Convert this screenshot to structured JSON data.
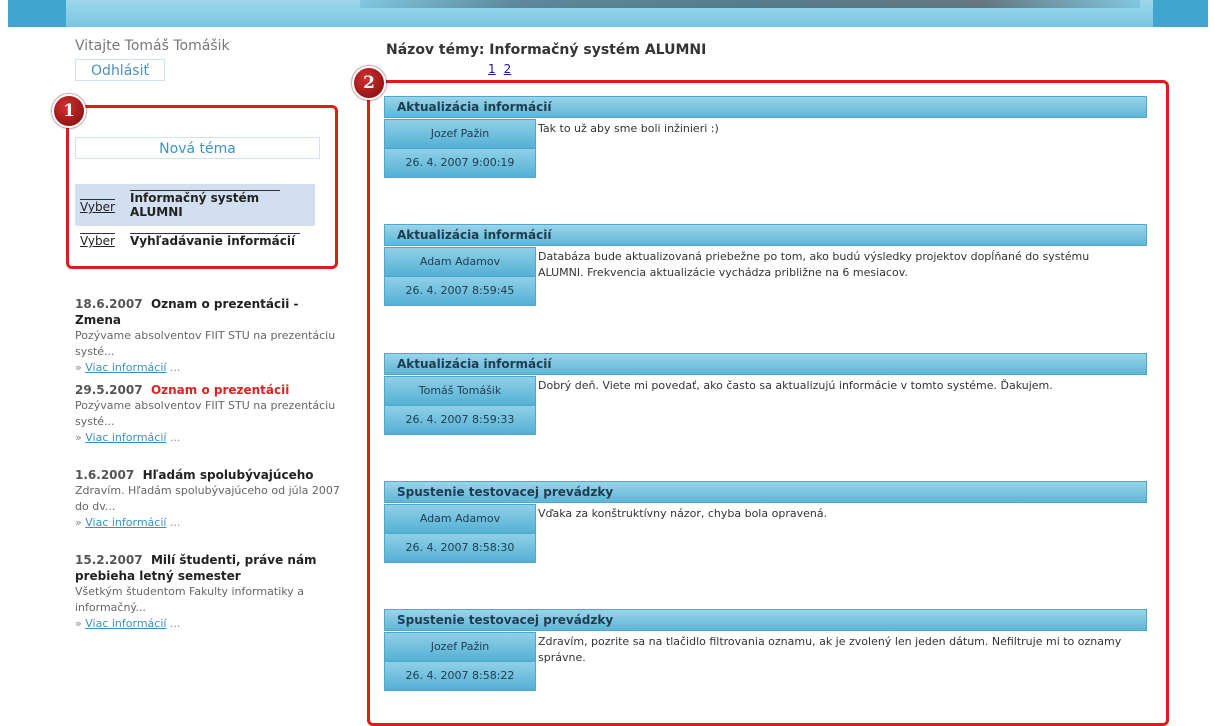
{
  "colors": {
    "accent": "#5db6d8",
    "annotation_red": "#e21a1a",
    "selected_row": "#d2dff0",
    "link": "#3a8fc0"
  },
  "header": {
    "welcome": "Vitajte Tomáš Tomášik",
    "logout_label": "Odhlásiť"
  },
  "annotations": [
    "1",
    "2"
  ],
  "sidebar": {
    "new_topic_label": "Nová téma",
    "topics": [
      {
        "action": "Vyber",
        "name": "Informačný systém ALUMNI",
        "selected": true
      },
      {
        "action": "Vyber",
        "name": "Vyhľadávanie informácií",
        "selected": false
      }
    ]
  },
  "news": [
    {
      "date": "18.6.2007",
      "title": "Oznam o prezentácii - Zmena",
      "text": "Pozývame absolventov FIIT STU na prezentáciu systé...",
      "more": "Viac informácií"
    },
    {
      "date": "29.5.2007",
      "title": "Oznam o prezentácii",
      "text": "Pozývame absolventov FIIT STU na prezentáciu systé...",
      "more": "Viac informácií"
    },
    {
      "date": "1.6.2007",
      "title": "Hľadám spolubývajúceho",
      "text": "Zdravím. Hľadám spolubývajúceho od júla 2007 do dv...",
      "more": "Viac informácií"
    },
    {
      "date": "15.2.2007",
      "title": "Milí študenti, práve nám prebieha letný semester",
      "text": "Všetkým študentom Fakulty informatiky a informačný...",
      "more": "Viac informácií"
    }
  ],
  "main": {
    "topic_title": "Názov témy: Informačný systém ALUMNI",
    "pages": [
      "1",
      "2"
    ],
    "posts": [
      {
        "subject": "Aktualizácia informácií",
        "author": "Jozef Pažin",
        "timestamp": "26. 4. 2007 9:00:19",
        "message": "Tak to už aby sme boli inžinieri :)"
      },
      {
        "subject": "Aktualizácia informácií",
        "author": "Adam Adamov",
        "timestamp": "26. 4. 2007 8:59:45",
        "message": "Databáza bude aktualizovaná priebežne po tom, ako budú výsledky projektov dopĺňané do systému ALUMNI. Frekvencia aktualizácie vychádza približne na 6 mesiacov."
      },
      {
        "subject": "Aktualizácia informácií",
        "author": "Tomáš Tomášik",
        "timestamp": "26. 4. 2007 8:59:33",
        "message": "Dobrý deň. Viete mi povedať, ako často sa aktualizujú informácie v tomto systéme. Ďakujem."
      },
      {
        "subject": "Spustenie testovacej prevádzky",
        "author": "Adam Adamov",
        "timestamp": "26. 4. 2007 8:58:30",
        "message": "Vďaka za konštruktívny názor, chyba bola opravená."
      },
      {
        "subject": "Spustenie testovacej prevádzky",
        "author": "Jozef Pažin",
        "timestamp": "26. 4. 2007 8:58:22",
        "message": "Zdravím, pozrite sa na tlačidlo filtrovania oznamu, ak je zvolený len jeden dátum. Nefiltruje mi to oznamy správne."
      }
    ]
  }
}
